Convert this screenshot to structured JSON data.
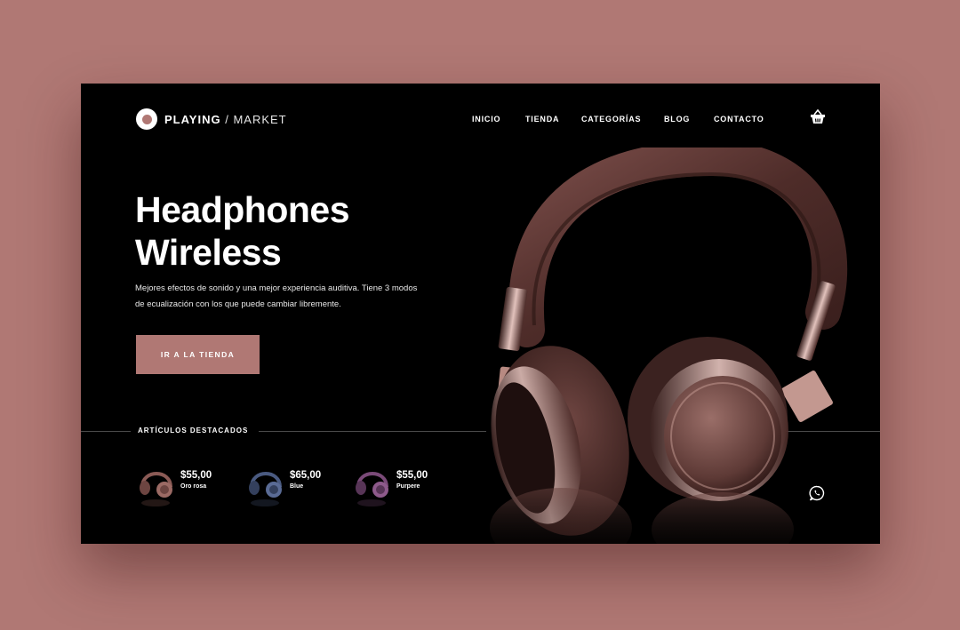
{
  "brand": {
    "bold": "PLAYING",
    "slash": " / ",
    "light": "MARKET"
  },
  "nav": [
    "INICIO",
    "TIENDA",
    "CATEGORÍAS",
    "BLOG",
    "CONTACTO"
  ],
  "hero": {
    "title_line1": "Headphones",
    "title_line2": "Wireless",
    "description": "Mejores efectos de sonido y una mejor experiencia auditiva. Tiene 3 modos de ecualización con los que puede cambiar libremente.",
    "cta_label": "IR A LA TIENDA"
  },
  "featured": {
    "label": "ARTÍCULOS DESTACADOS",
    "items": [
      {
        "price": "$55,00",
        "name": "Oro rosa",
        "color": "#8a5a55"
      },
      {
        "price": "$65,00",
        "name": "Blue",
        "color": "#4a5a80"
      },
      {
        "price": "$55,00",
        "name": "Purpere",
        "color": "#7a4a78"
      }
    ]
  },
  "colors": {
    "accent": "#b07874",
    "background": "#000000",
    "page": "#b07874"
  },
  "icons": {
    "cart": "shopping-basket-icon",
    "chat": "whatsapp-icon",
    "logo": "record-logo-icon"
  }
}
